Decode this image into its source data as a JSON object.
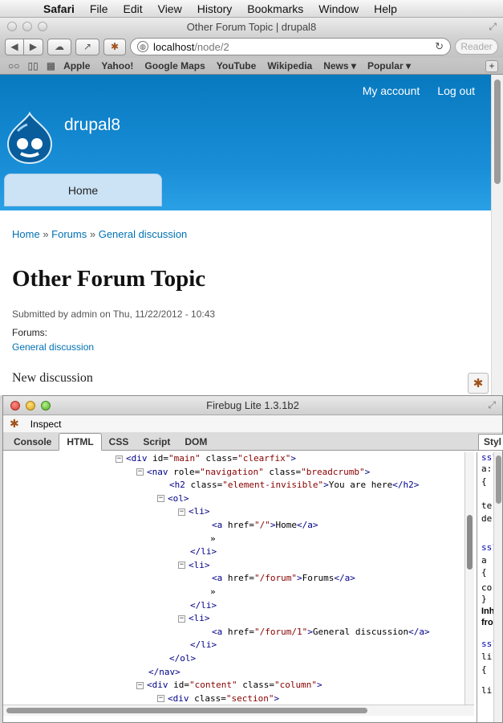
{
  "menubar": {
    "app": "Safari",
    "items": [
      "File",
      "Edit",
      "View",
      "History",
      "Bookmarks",
      "Window",
      "Help"
    ]
  },
  "safari": {
    "title": "Other Forum Topic | drupal8",
    "url_host": "localhost",
    "url_path": "/node/2",
    "reader_label": "Reader",
    "bookmarks": [
      "Apple",
      "Yahoo!",
      "Google Maps",
      "YouTube",
      "Wikipedia",
      "News ▾",
      "Popular ▾"
    ]
  },
  "site": {
    "secondary_links": [
      "My account",
      "Log out"
    ],
    "name": "drupal8",
    "primary_tab": "Home",
    "breadcrumb": [
      "Home",
      "Forums",
      "General discussion"
    ],
    "breadcrumb_sep": "»",
    "node_title": "Other Forum Topic",
    "submitted": "Submitted by admin on Thu, 11/22/2012 - 10:43",
    "forums_label": "Forums:",
    "forums_link": "General discussion",
    "new_discussion": "New discussion"
  },
  "firebug": {
    "title": "Firebug Lite 1.3.1b2",
    "inspect_label": "Inspect",
    "tabs": [
      "Console",
      "HTML",
      "CSS",
      "Script",
      "DOM"
    ],
    "active_tab": "HTML",
    "side_tab": "Styl",
    "side_lines": [
      "ss?",
      "a:",
      "{",
      "te",
      "de",
      "ss?",
      "a",
      "{",
      "co",
      "}",
      "Inh",
      "fro",
      "ss?",
      "li",
      "{",
      "li"
    ]
  },
  "dom_tree": [
    {
      "twisty": "−",
      "html": "<span class='tag'>&lt;div</span> <span class='attr'>id=</span><span class='val'>\"main\"</span> <span class='attr'>class=</span><span class='val'>\"clearfix\"</span><span class='tag'>&gt;</span>"
    },
    {
      "twisty": "−",
      "html": "<span class='tag'>&lt;nav</span> <span class='attr'>role=</span><span class='val'>\"navigation\"</span> <span class='attr'>class=</span><span class='val'>\"breadcrumb\"</span><span class='tag'>&gt;</span>"
    },
    {
      "twisty": "",
      "html": "<span class='tag'>&lt;h2</span> <span class='attr'>class=</span><span class='val'>\"element-invisible\"</span><span class='tag'>&gt;</span><span class='txt'>You are here</span><span class='tag'>&lt;/h2&gt;</span>"
    },
    {
      "twisty": "−",
      "html": "<span class='tag'>&lt;ol&gt;</span>"
    },
    {
      "twisty": "−",
      "html": "<span class='tag'>&lt;li&gt;</span>"
    },
    {
      "twisty": "",
      "html": "<span class='tag'>&lt;a</span> <span class='attr'>href=</span><span class='val'>\"/\"</span><span class='tag'>&gt;</span><span class='txt'>Home</span><span class='tag'>&lt;/a&gt;</span>"
    },
    {
      "twisty": "",
      "html": "<span class='txt'>»</span>"
    },
    {
      "twisty": "",
      "html": "<span class='tag'>&lt;/li&gt;</span>"
    },
    {
      "twisty": "−",
      "html": "<span class='tag'>&lt;li&gt;</span>"
    },
    {
      "twisty": "",
      "html": "<span class='tag'>&lt;a</span> <span class='attr'>href=</span><span class='val'>\"/forum\"</span><span class='tag'>&gt;</span><span class='txt'>Forums</span><span class='tag'>&lt;/a&gt;</span>"
    },
    {
      "twisty": "",
      "html": "<span class='txt'>»</span>"
    },
    {
      "twisty": "",
      "html": "<span class='tag'>&lt;/li&gt;</span>"
    },
    {
      "twisty": "−",
      "html": "<span class='tag'>&lt;li&gt;</span>"
    },
    {
      "twisty": "",
      "html": "<span class='tag'>&lt;a</span> <span class='attr'>href=</span><span class='val'>\"/forum/1\"</span><span class='tag'>&gt;</span><span class='txt'>General discussion</span><span class='tag'>&lt;/a&gt;</span>"
    },
    {
      "twisty": "",
      "html": "<span class='tag'>&lt;/li&gt;</span>"
    },
    {
      "twisty": "",
      "html": "<span class='tag'>&lt;/ol&gt;</span>"
    },
    {
      "twisty": "",
      "html": "<span class='tag'>&lt;/nav&gt;</span>"
    },
    {
      "twisty": "−",
      "html": "<span class='tag'>&lt;div</span> <span class='attr'>id=</span><span class='val'>\"content\"</span> <span class='attr'>class=</span><span class='val'>\"column\"</span><span class='tag'>&gt;</span>"
    },
    {
      "twisty": "−",
      "html": "<span class='tag'>&lt;div</span> <span class='attr'>class=</span><span class='val'>\"section\"</span><span class='tag'>&gt;</span>"
    }
  ]
}
